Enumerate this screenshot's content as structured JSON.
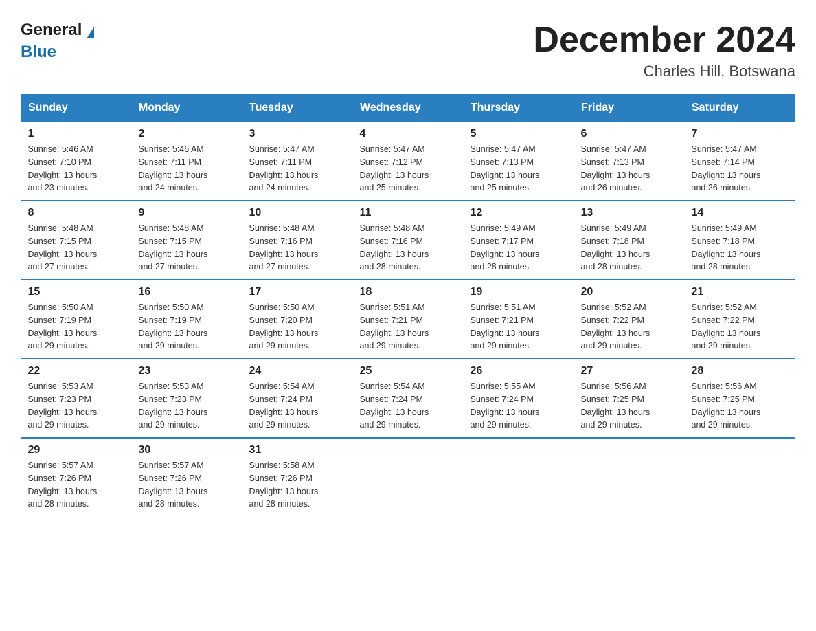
{
  "logo": {
    "general": "General",
    "blue": "Blue"
  },
  "title": "December 2024",
  "subtitle": "Charles Hill, Botswana",
  "days_header": [
    "Sunday",
    "Monday",
    "Tuesday",
    "Wednesday",
    "Thursday",
    "Friday",
    "Saturday"
  ],
  "weeks": [
    [
      {
        "day": "1",
        "sunrise": "5:46 AM",
        "sunset": "7:10 PM",
        "daylight": "13 hours and 23 minutes."
      },
      {
        "day": "2",
        "sunrise": "5:46 AM",
        "sunset": "7:11 PM",
        "daylight": "13 hours and 24 minutes."
      },
      {
        "day": "3",
        "sunrise": "5:47 AM",
        "sunset": "7:11 PM",
        "daylight": "13 hours and 24 minutes."
      },
      {
        "day": "4",
        "sunrise": "5:47 AM",
        "sunset": "7:12 PM",
        "daylight": "13 hours and 25 minutes."
      },
      {
        "day": "5",
        "sunrise": "5:47 AM",
        "sunset": "7:13 PM",
        "daylight": "13 hours and 25 minutes."
      },
      {
        "day": "6",
        "sunrise": "5:47 AM",
        "sunset": "7:13 PM",
        "daylight": "13 hours and 26 minutes."
      },
      {
        "day": "7",
        "sunrise": "5:47 AM",
        "sunset": "7:14 PM",
        "daylight": "13 hours and 26 minutes."
      }
    ],
    [
      {
        "day": "8",
        "sunrise": "5:48 AM",
        "sunset": "7:15 PM",
        "daylight": "13 hours and 27 minutes."
      },
      {
        "day": "9",
        "sunrise": "5:48 AM",
        "sunset": "7:15 PM",
        "daylight": "13 hours and 27 minutes."
      },
      {
        "day": "10",
        "sunrise": "5:48 AM",
        "sunset": "7:16 PM",
        "daylight": "13 hours and 27 minutes."
      },
      {
        "day": "11",
        "sunrise": "5:48 AM",
        "sunset": "7:16 PM",
        "daylight": "13 hours and 28 minutes."
      },
      {
        "day": "12",
        "sunrise": "5:49 AM",
        "sunset": "7:17 PM",
        "daylight": "13 hours and 28 minutes."
      },
      {
        "day": "13",
        "sunrise": "5:49 AM",
        "sunset": "7:18 PM",
        "daylight": "13 hours and 28 minutes."
      },
      {
        "day": "14",
        "sunrise": "5:49 AM",
        "sunset": "7:18 PM",
        "daylight": "13 hours and 28 minutes."
      }
    ],
    [
      {
        "day": "15",
        "sunrise": "5:50 AM",
        "sunset": "7:19 PM",
        "daylight": "13 hours and 29 minutes."
      },
      {
        "day": "16",
        "sunrise": "5:50 AM",
        "sunset": "7:19 PM",
        "daylight": "13 hours and 29 minutes."
      },
      {
        "day": "17",
        "sunrise": "5:50 AM",
        "sunset": "7:20 PM",
        "daylight": "13 hours and 29 minutes."
      },
      {
        "day": "18",
        "sunrise": "5:51 AM",
        "sunset": "7:21 PM",
        "daylight": "13 hours and 29 minutes."
      },
      {
        "day": "19",
        "sunrise": "5:51 AM",
        "sunset": "7:21 PM",
        "daylight": "13 hours and 29 minutes."
      },
      {
        "day": "20",
        "sunrise": "5:52 AM",
        "sunset": "7:22 PM",
        "daylight": "13 hours and 29 minutes."
      },
      {
        "day": "21",
        "sunrise": "5:52 AM",
        "sunset": "7:22 PM",
        "daylight": "13 hours and 29 minutes."
      }
    ],
    [
      {
        "day": "22",
        "sunrise": "5:53 AM",
        "sunset": "7:23 PM",
        "daylight": "13 hours and 29 minutes."
      },
      {
        "day": "23",
        "sunrise": "5:53 AM",
        "sunset": "7:23 PM",
        "daylight": "13 hours and 29 minutes."
      },
      {
        "day": "24",
        "sunrise": "5:54 AM",
        "sunset": "7:24 PM",
        "daylight": "13 hours and 29 minutes."
      },
      {
        "day": "25",
        "sunrise": "5:54 AM",
        "sunset": "7:24 PM",
        "daylight": "13 hours and 29 minutes."
      },
      {
        "day": "26",
        "sunrise": "5:55 AM",
        "sunset": "7:24 PM",
        "daylight": "13 hours and 29 minutes."
      },
      {
        "day": "27",
        "sunrise": "5:56 AM",
        "sunset": "7:25 PM",
        "daylight": "13 hours and 29 minutes."
      },
      {
        "day": "28",
        "sunrise": "5:56 AM",
        "sunset": "7:25 PM",
        "daylight": "13 hours and 29 minutes."
      }
    ],
    [
      {
        "day": "29",
        "sunrise": "5:57 AM",
        "sunset": "7:26 PM",
        "daylight": "13 hours and 28 minutes."
      },
      {
        "day": "30",
        "sunrise": "5:57 AM",
        "sunset": "7:26 PM",
        "daylight": "13 hours and 28 minutes."
      },
      {
        "day": "31",
        "sunrise": "5:58 AM",
        "sunset": "7:26 PM",
        "daylight": "13 hours and 28 minutes."
      },
      null,
      null,
      null,
      null
    ]
  ],
  "labels": {
    "sunrise": "Sunrise:",
    "sunset": "Sunset:",
    "daylight": "Daylight:"
  }
}
